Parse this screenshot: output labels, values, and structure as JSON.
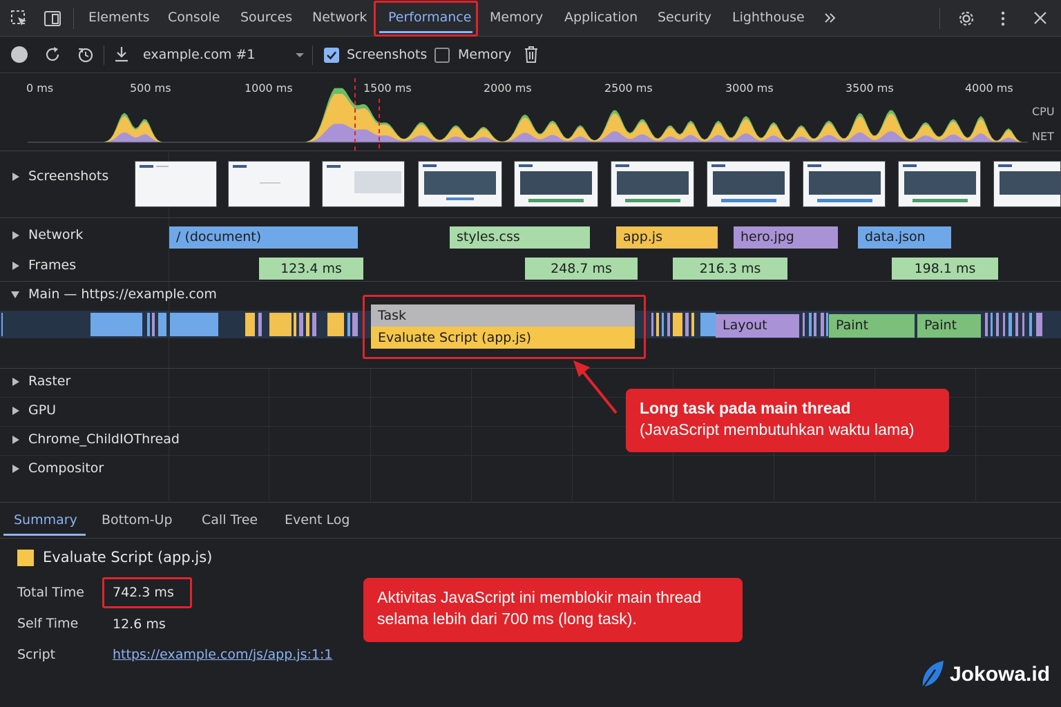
{
  "tabs": [
    "Elements",
    "Console",
    "Sources",
    "Network",
    "Performance",
    "Memory",
    "Application",
    "Security",
    "Lighthouse"
  ],
  "active_tab": "Performance",
  "icons": {
    "inspect": "inspect-element-icon",
    "device": "device-toolbar-icon",
    "more_tabs": "chevron-double-right-icon",
    "settings": "gear-icon",
    "kebab": "more-vertical-icon",
    "close": "close-icon",
    "record": "record-icon",
    "reload": "reload-profile-icon",
    "clear": "clear-history-icon",
    "download": "download-icon",
    "dropdown": "dropdown-arrow-icon",
    "trash": "trash-icon",
    "logo": "feather-logo-icon"
  },
  "toolbar": {
    "recording": "example.com #1",
    "screenshots_label": "Screenshots",
    "screenshots_checked": true,
    "memory_label": "Memory",
    "memory_checked": false
  },
  "ruler": [
    "0 ms",
    "500 ms",
    "1000 ms",
    "1500 ms",
    "2000 ms",
    "2500 ms",
    "3000 ms",
    "3500 ms",
    "4000 ms"
  ],
  "overview_labels": {
    "cpu": "CPU",
    "net": "NET"
  },
  "tracks": {
    "screenshots": "Screenshots",
    "network": "Network",
    "frames": "Frames",
    "main": "Main — https://example.com",
    "raster": "Raster",
    "gpu": "GPU",
    "io": "Chrome_ChildIOThread",
    "compositor": "Compositor"
  },
  "network_requests": [
    {
      "name": "/ (document)",
      "color": "#6fa8e8"
    },
    {
      "name": "styles.css",
      "color": "#a8dba8"
    },
    {
      "name": "app.js",
      "color": "#f2c14e"
    },
    {
      "name": "hero.jpg",
      "color": "#a993d6"
    },
    {
      "name": "data.json",
      "color": "#6fa8e8"
    }
  ],
  "frames": [
    "123.4 ms",
    "248.7 ms",
    "216.3 ms",
    "198.1 ms"
  ],
  "main_events": {
    "task": "Task",
    "evaluate": "Evaluate Script (app.js)",
    "layout": "Layout",
    "paint1": "Paint",
    "paint2": "Paint"
  },
  "callouts": {
    "long_task": [
      "Long task pada main thread",
      "(JavaScript membutuhkan waktu lama)"
    ],
    "summary_note": [
      "Aktivitas JavaScript ini memblokir main thread",
      "selama lebih dari 700 ms (long task)."
    ]
  },
  "bottom_tabs": [
    "Summary",
    "Bottom-Up",
    "Call Tree",
    "Event Log"
  ],
  "active_bottom_tab": "Summary",
  "summary": {
    "title": "Evaluate Script (app.js)",
    "total_time_label": "Total Time",
    "total_time": "742.3 ms",
    "self_time_label": "Self Time",
    "self_time": "12.6 ms",
    "script_label": "Script",
    "script_link": "https://example.com/js/app.js:1:1"
  },
  "brand": "Jokowa.id",
  "colors": {
    "accent": "#8ab4f8",
    "highlight": "#e0242b",
    "scripting": "#f2c14e",
    "rendering": "#a993d6",
    "painting": "#7cbf7a",
    "loading": "#6fa8e8"
  }
}
